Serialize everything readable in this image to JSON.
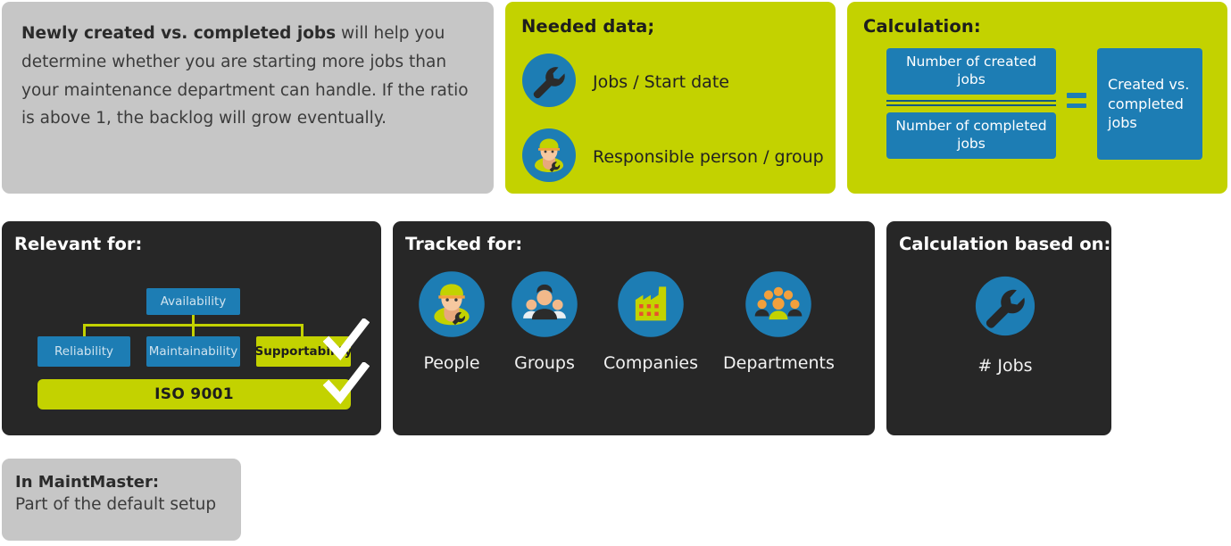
{
  "colors": {
    "green": "#c3d200",
    "blue": "#1d7db4",
    "dark": "#272727",
    "gray": "#c6c6c6",
    "white": "#ffffff",
    "orange": "#f2a03c",
    "red": "#e8502e"
  },
  "description_card": {
    "bold_lead": "Newly created vs. completed jobs",
    "rest": " will help you determine whether you are starting more jobs than your maintenance department can handle. If the ratio is above 1, the backlog will grow eventually."
  },
  "needed_data_card": {
    "title": "Needed data;",
    "items": [
      {
        "icon": "wrench-icon",
        "label": "Jobs / Start date"
      },
      {
        "icon": "worker-person-icon",
        "label": "Responsible person / group"
      }
    ]
  },
  "calculation_card": {
    "title": "Calculation:",
    "numerator": "Number of created jobs",
    "denominator": "Number of completed jobs",
    "operator": "equals-sign-icon",
    "result": "Created vs. completed jobs"
  },
  "relevant_for_card": {
    "title": "Relevant for:",
    "tree": {
      "root": "Availability",
      "children": [
        "Reliability",
        "Maintainability",
        "Supportability"
      ],
      "highlighted": "Supportability"
    },
    "standard": "ISO 9001",
    "checkmarks": [
      "check-supportability",
      "check-iso9001"
    ]
  },
  "tracked_for_card": {
    "title": "Tracked for:",
    "items": [
      {
        "icon": "worker-person-icon",
        "label": "People"
      },
      {
        "icon": "group-people-icon",
        "label": "Groups"
      },
      {
        "icon": "factory-icon",
        "label": "Companies"
      },
      {
        "icon": "departments-people-icon",
        "label": "Departments"
      }
    ]
  },
  "calculation_based_on_card": {
    "title": "Calculation based on:",
    "icon": "wrench-circle-icon",
    "label": "# Jobs"
  },
  "in_maintmaster_card": {
    "title": "In MaintMaster:",
    "subtitle": "Part of the default setup"
  }
}
